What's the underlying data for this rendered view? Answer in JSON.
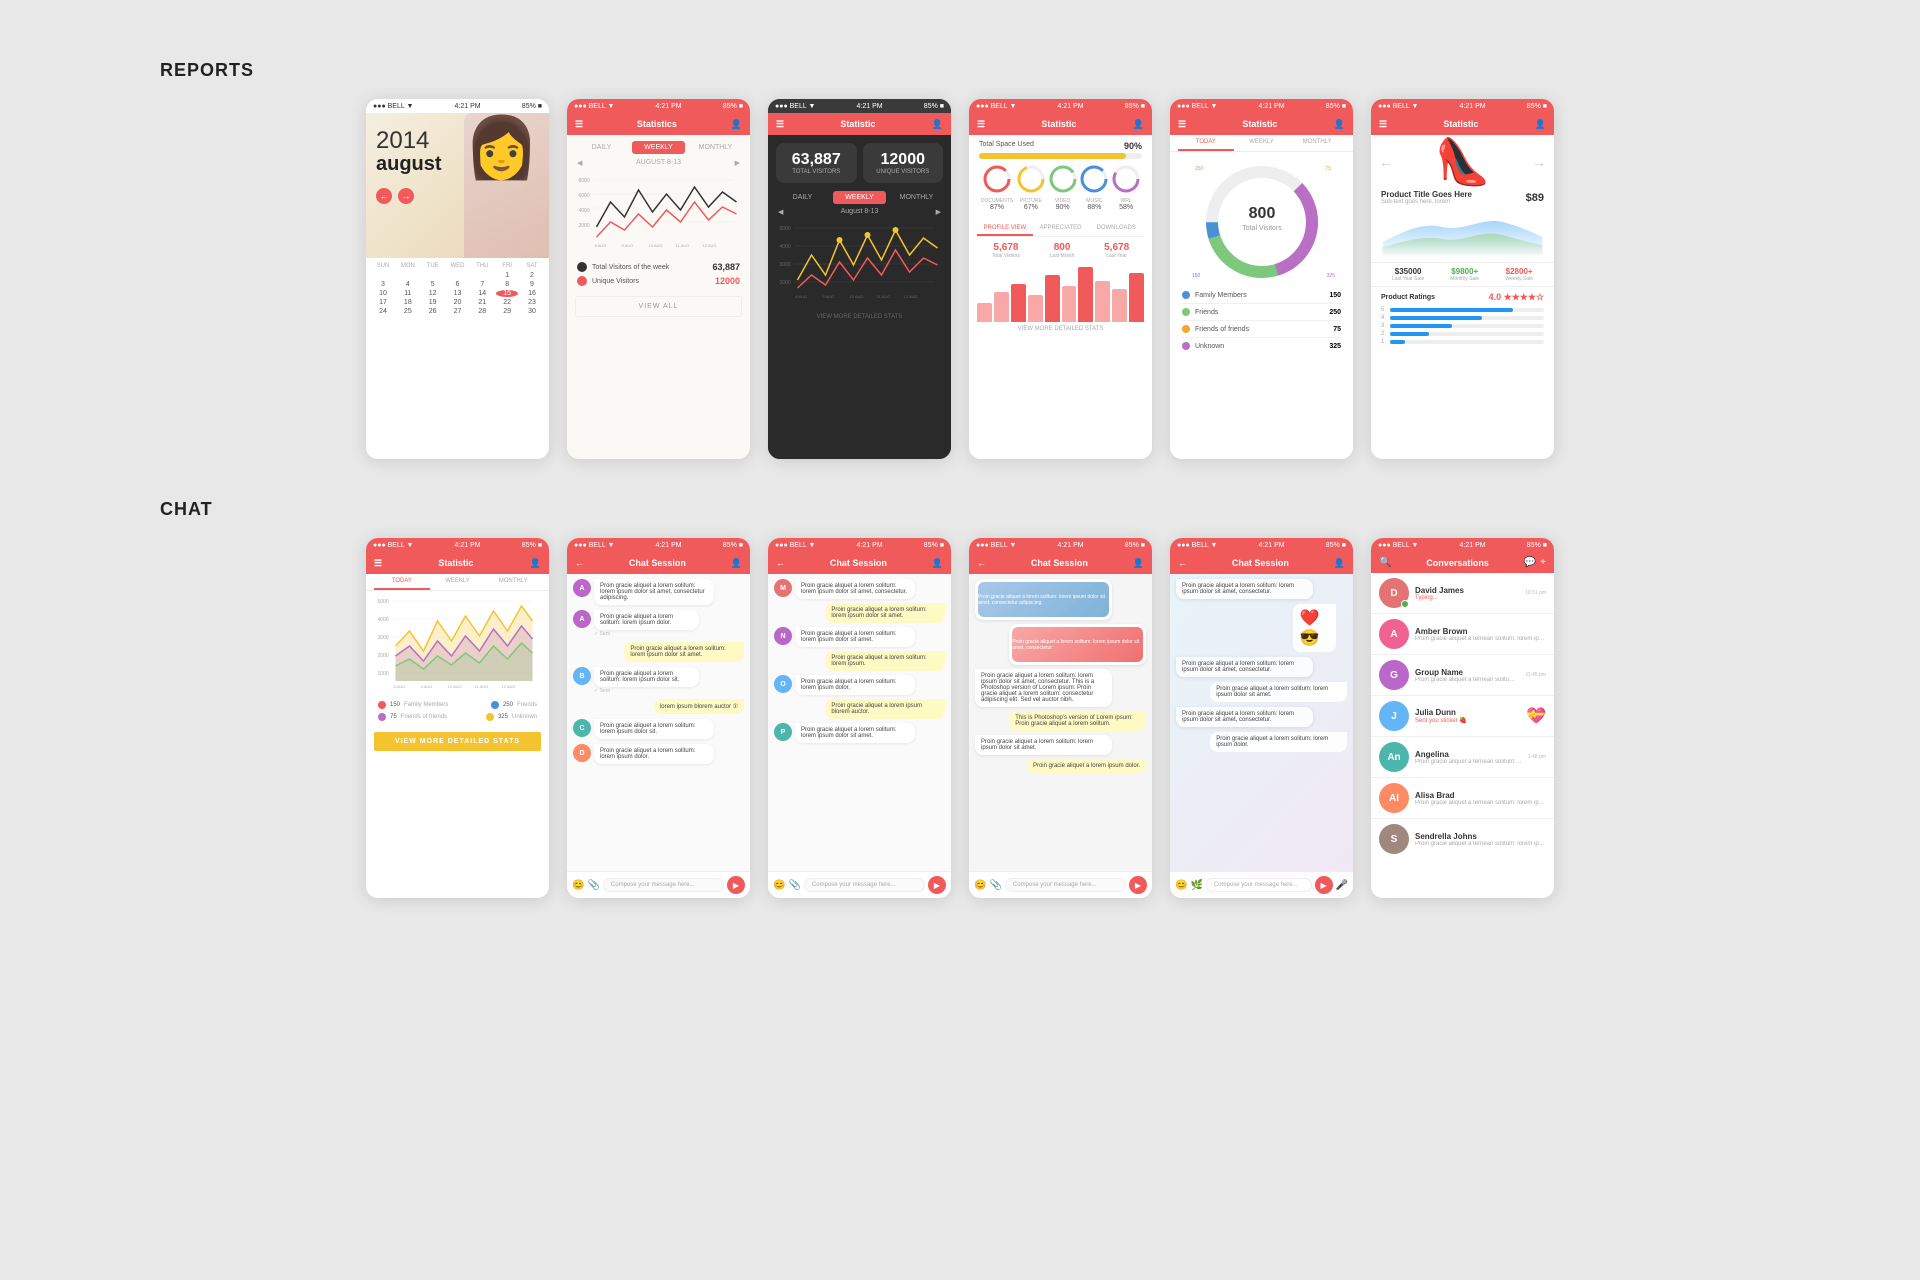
{
  "sections": {
    "reports_label": "REPORTS",
    "chat_label": "CHAT"
  },
  "status_bar": {
    "left": "●●● BELL ▼",
    "time": "4:21 PM",
    "right": "85% ■"
  },
  "phones": {
    "calendar": {
      "year": "2014",
      "month": "august",
      "days_header": [
        "SUN",
        "MON",
        "TUE",
        "WED",
        "THU",
        "FRI",
        "SAT"
      ],
      "weeks": [
        [
          "",
          "",
          "",
          "",
          "",
          "1",
          "2"
        ],
        [
          "3",
          "4",
          "5",
          "6",
          "7",
          "8",
          "9"
        ],
        [
          "10",
          "11",
          "12",
          "13",
          "14",
          "15",
          "16"
        ],
        [
          "17",
          "18",
          "19",
          "20",
          "21",
          "22",
          "23"
        ],
        [
          "24",
          "25",
          "26",
          "27",
          "28",
          "29",
          "30"
        ]
      ],
      "today": "15"
    },
    "statistics_tab": {
      "title": "Statistics",
      "tabs": [
        "DAILY",
        "WEEKLY",
        "MONTHLY"
      ],
      "active_tab": "WEEKLY",
      "date_range": "AUGUST 8-13",
      "stat1_num": "63,887",
      "stat1_label": "TOTAL VISITORS",
      "stat2_num": "12000",
      "stat2_label": "UNIQUE VISITORS",
      "view_all": "VIEW ALL"
    },
    "statistic_dark": {
      "title": "Statistic",
      "tabs": [
        "DAILY",
        "WEEKLY",
        "MONTHLY"
      ],
      "date_range": "August 8-13",
      "view_more": "VIEW MORE DETAILED STATS"
    },
    "statistic_space": {
      "title": "Statistic",
      "space_label": "Total Space Used",
      "space_pct": "90%",
      "file_types": [
        "DOCUMENTS",
        "PICTURE",
        "VIDEO",
        "MUSIC",
        "WRL"
      ],
      "file_pcts": [
        "87%",
        "67%",
        "90%",
        "88%",
        "58%"
      ],
      "tab_labels": [
        "PROFILE VIEW",
        "APPRECIATED",
        "DOWNLOADS"
      ],
      "stats": [
        {
          "num": "5,678",
          "label": "Total Visitors"
        },
        {
          "num": "800",
          "label": "Last Month"
        },
        {
          "num": "5,678",
          "label": "Last Year"
        }
      ],
      "view_more": "VIEW MORE DETAILED STATS"
    },
    "statistic_circle": {
      "title": "Statistic",
      "tabs": [
        "TODAY",
        "WEEKLY",
        "MONTHLY"
      ],
      "circle_num": "800",
      "circle_label": "Total Visitors",
      "legend": [
        {
          "color": "#4a90d9",
          "label": "Family Members",
          "value": "150"
        },
        {
          "color": "#7ec87e",
          "label": "Friends",
          "value": "250"
        },
        {
          "color": "#f0a830",
          "label": "Friends of friends",
          "value": "75"
        },
        {
          "color": "#b86fc4",
          "label": "Unknown",
          "value": "325"
        }
      ]
    },
    "statistic_product": {
      "title": "Statistic",
      "product_title": "Product Title Goes Here",
      "product_sub": "Sub-text goes here, lorem",
      "product_price": "$89",
      "prices": [
        {
          "num": "$35000",
          "label": "Last Year Sale",
          "color": "normal"
        },
        {
          "num": "$9800+",
          "label": "Monthly Sale",
          "color": "green"
        },
        {
          "num": "$2800+",
          "label": "Weekly Sale",
          "color": "red"
        }
      ],
      "ratings_title": "Product Ratings",
      "rating_score": "4.0",
      "bar_widths": [
        "80%",
        "60%",
        "40%",
        "25%",
        "10%"
      ]
    }
  },
  "chat_phones": {
    "stat_chart": {
      "title": "Statistic",
      "legend": [
        {
          "color": "#f05a5b",
          "label": "Family Members",
          "value": "150"
        },
        {
          "color": "#4a90d9",
          "label": "Friends",
          "value": "250"
        },
        {
          "color": "#b86fc4",
          "label": "Friends of friends",
          "value": "75"
        },
        {
          "color": "#f4c430",
          "label": "Unknown",
          "value": "325"
        }
      ],
      "view_more": "VIEW MORE DETAILED STATS"
    },
    "chat_session": {
      "title": "Chat Session",
      "back_icon": "←",
      "messages": [
        {
          "side": "left",
          "text": "Proin gracie aliquet a lorem solitum: lorem ipsum dolor sit amet, consectetur adipiscing",
          "time": ""
        },
        {
          "side": "left",
          "text": "Proin gracie aliquet a lorem solitum: lorem ipsum dolor",
          "time": "✓ Sent"
        },
        {
          "side": "right",
          "text": "Proin gracie aliquet a lorem solitum: lorem ipsum dolor sit amet",
          "time": ""
        },
        {
          "side": "left",
          "text": "Proin gracie aliquet a lorem solitum: lorem ipsum dolor sit",
          "time": "✓ Sent"
        },
        {
          "side": "right",
          "text": "lorem ipsum blorem auctor ①",
          "time": ""
        },
        {
          "side": "left",
          "text": "Proin gracie aliquet a lorem solitum: lorem ipsum dolor sit",
          "time": ""
        },
        {
          "side": "left",
          "text": "Proin gracie aliquet a lorem solitum: lorem ipsum dolor",
          "time": ""
        }
      ],
      "input_placeholder": "Compose your message here..."
    },
    "conversations": {
      "title": "Conversations",
      "contacts": [
        {
          "name": "David James",
          "msg": "Typing...",
          "time": "10:31 pm",
          "avatar": "D",
          "color": "#e57373",
          "typing": true
        },
        {
          "name": "Amber Brown",
          "msg": "Proin gracie aliquet a ternean solitum: lorem ipsum dolor sit amet, consectetur",
          "time": "",
          "avatar": "A",
          "color": "#f06292",
          "typing": false
        },
        {
          "name": "Group Name",
          "msg": "Proin gracie aliquet a ternean solitum: lorem ipsum dolor sit amet, consectetur",
          "time": "11:45 pm",
          "avatar": "G",
          "color": "#ba68c8",
          "typing": false
        },
        {
          "name": "Julia Dunn",
          "msg": "Sent you sticker 🍓",
          "time": "",
          "avatar": "J",
          "color": "#64b5f6",
          "typing": false
        },
        {
          "name": "Angelina",
          "msg": "Proin gracie aliquet a ternean solitum: lorem ipsum dolor sit amet, consectetur",
          "time": "1:48 pm",
          "avatar": "An",
          "color": "#4db6ac",
          "typing": false
        },
        {
          "name": "Alisa Brad",
          "msg": "Proin gracie aliquet a ternean solitum: lorem ipsum dolor sit amet, consectetur",
          "time": "",
          "avatar": "Al",
          "color": "#ff8a65",
          "typing": false
        },
        {
          "name": "Sendrella Johns",
          "msg": "Proin gracie aliquet a ternean solitum: lorem ipsum dolor sit amet, consectetur",
          "time": "",
          "avatar": "S",
          "color": "#a1887f",
          "typing": false
        }
      ]
    }
  }
}
